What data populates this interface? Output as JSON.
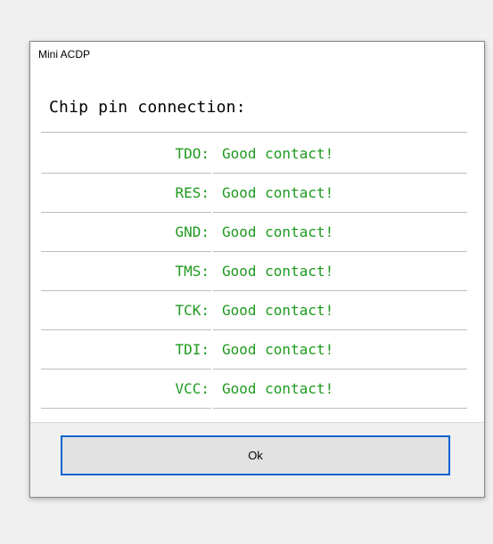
{
  "window": {
    "title": "Mini ACDP"
  },
  "dialog": {
    "heading": "Chip pin connection:",
    "rows": [
      {
        "pin": "TDO:",
        "status": "Good contact!"
      },
      {
        "pin": "RES:",
        "status": "Good contact!"
      },
      {
        "pin": "GND:",
        "status": "Good contact!"
      },
      {
        "pin": "TMS:",
        "status": "Good contact!"
      },
      {
        "pin": "TCK:",
        "status": "Good contact!"
      },
      {
        "pin": "TDI:",
        "status": "Good contact!"
      },
      {
        "pin": "VCC:",
        "status": "Good contact!"
      }
    ],
    "ok_label": "Ok"
  },
  "colors": {
    "status_text": "#1e9a1e",
    "button_border": "#0a64d2",
    "button_bg": "#e1e1e1",
    "footer_bg": "#f0f0f0"
  }
}
